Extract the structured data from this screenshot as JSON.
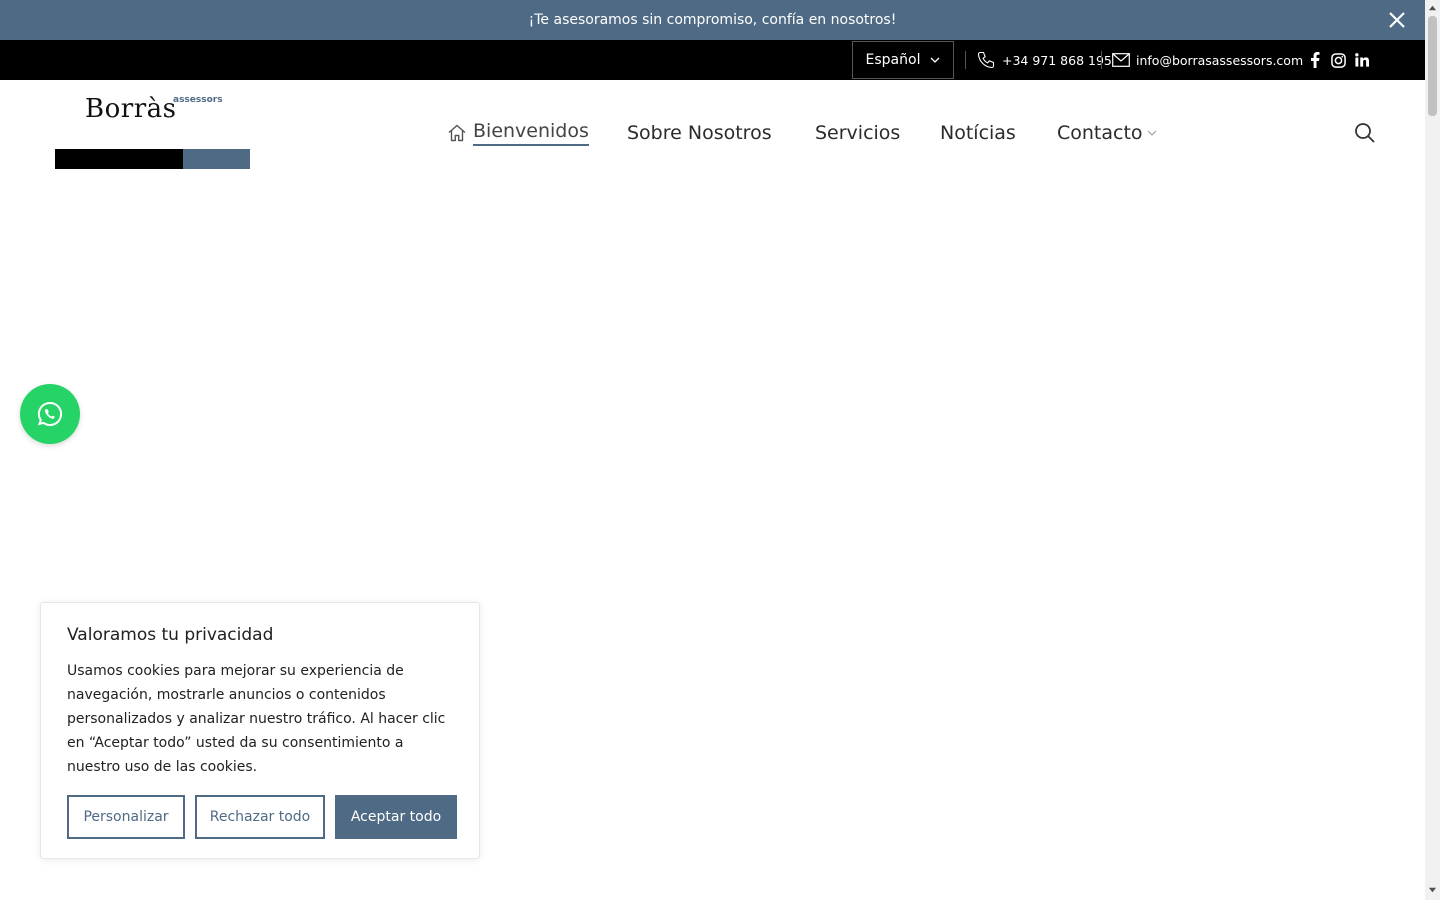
{
  "announcement": {
    "text": "¡Te asesoramos sin compromiso, confía en nosotros!"
  },
  "topbar": {
    "language": "Español",
    "phone": "+34 971 868 195",
    "email": "info@borrasassessors.com",
    "social": [
      "facebook-icon",
      "instagram-icon",
      "linkedin-icon"
    ]
  },
  "logo": {
    "name": "Borràs",
    "sub": "assessors"
  },
  "nav": {
    "items": [
      {
        "label": "Bienvenidos",
        "active": true
      },
      {
        "label": "Sobre Nosotros"
      },
      {
        "label": "Servicios"
      },
      {
        "label": "Notícias"
      },
      {
        "label": "Contacto",
        "dropdown": true
      }
    ]
  },
  "cookie": {
    "title": "Valoramos tu privacidad",
    "body": "Usamos cookies para mejorar su experiencia de navegación, mostrarle anuncios o contenidos personalizados y analizar nuestro tráfico. Al hacer clic en “Aceptar todo” usted da su consentimiento a nuestro uso de las cookies.",
    "customize": "Personalizar",
    "reject": "Rechazar todo",
    "accept": "Aceptar todo"
  },
  "colors": {
    "brand": "#4f6a85",
    "whatsapp": "#25d366",
    "topbar": "#000000"
  }
}
